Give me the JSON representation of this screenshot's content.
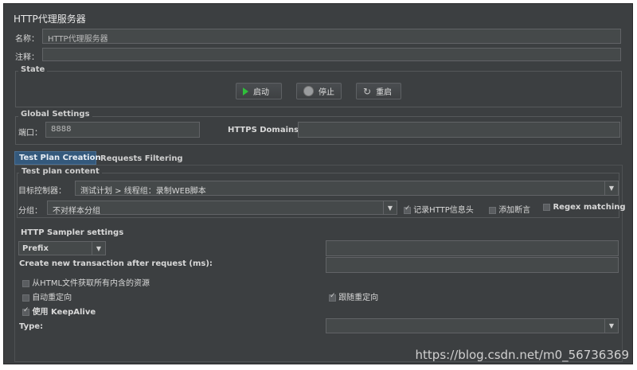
{
  "title": "HTTP代理服务器",
  "name_label": "名称：",
  "name_value": "HTTP代理服务器",
  "comment_label": "注释：",
  "comment_value": "",
  "state": {
    "title": "State",
    "start_label": "启动",
    "stop_label": "停止",
    "restart_label": "重启"
  },
  "global": {
    "title": "Global Settings",
    "port_label": "端口：",
    "port_value": "8888",
    "https_label": "HTTPS Domains:",
    "https_value": ""
  },
  "tabs": [
    {
      "label": "Test Plan Creation",
      "active": true
    },
    {
      "label": "Requests Filtering",
      "active": false
    }
  ],
  "test_plan": {
    "title": "Test plan content",
    "target_label": "目标控制器：",
    "target_value": "测试计划 > 线程组：录制WEB脚本",
    "grouping_label": "分组：",
    "grouping_value": "不对样本分组",
    "record_headers_label": "记录HTTP信息头",
    "record_headers_checked": true,
    "add_assertions_label": "添加断言",
    "add_assertions_checked": false,
    "regex_label": "Regex matching",
    "regex_checked": false
  },
  "sampler": {
    "title": "HTTP Sampler settings",
    "prefix_value": "Prefix",
    "prefix_text": "",
    "transaction_label": "Create new transaction after request (ms):",
    "transaction_value": "",
    "retrieve_label": "从HTML文件获取所有内含的资源",
    "retrieve_checked": false,
    "auto_redirect_label": "自动重定向",
    "auto_redirect_checked": false,
    "follow_redirect_label": "跟随重定向",
    "follow_redirect_checked": true,
    "keepalive_label": "使用 KeepAlive",
    "keepalive_checked": true,
    "type_label": "Type:",
    "type_value": ""
  },
  "watermark": "https://blog.csdn.net/m0_56736369",
  "colors": {
    "background": "#3c3f41",
    "field": "#45494a",
    "border": "#616366",
    "text": "#d8d8d8",
    "tab_active": "#34597c",
    "start_icon": "#2fbf3a"
  },
  "icons": {
    "start": "play-icon",
    "stop": "stop-icon",
    "restart": "restart-icon",
    "dropdown": "chevron-down-icon"
  }
}
